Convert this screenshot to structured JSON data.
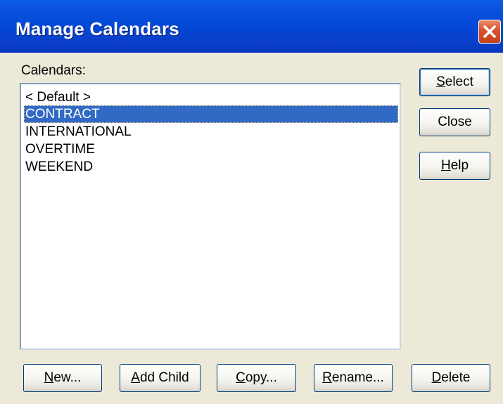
{
  "window": {
    "title": "Manage Calendars"
  },
  "list": {
    "label": "Calendars:",
    "items": [
      "< Default >",
      "CONTRACT",
      "INTERNATIONAL",
      "OVERTIME",
      "WEEKEND"
    ],
    "selected_index": 1
  },
  "side_buttons": {
    "select": {
      "mnemonic": "S",
      "rest": "elect"
    },
    "close": "Close",
    "help": {
      "mnemonic": "H",
      "rest": "elp"
    }
  },
  "bottom_buttons": {
    "new": {
      "mnemonic": "N",
      "rest": "ew..."
    },
    "add_child": {
      "mnemonic": "A",
      "rest": "dd Child"
    },
    "copy": {
      "mnemonic": "C",
      "rest": "opy..."
    },
    "rename": {
      "mnemonic": "R",
      "rest": "ename..."
    },
    "delete": {
      "mnemonic": "D",
      "rest": "elete"
    }
  },
  "colors": {
    "title_bar": "#0348d6",
    "selection": "#316ac5",
    "close_button": "#d8532c",
    "dialog_face": "#ece9d8"
  }
}
